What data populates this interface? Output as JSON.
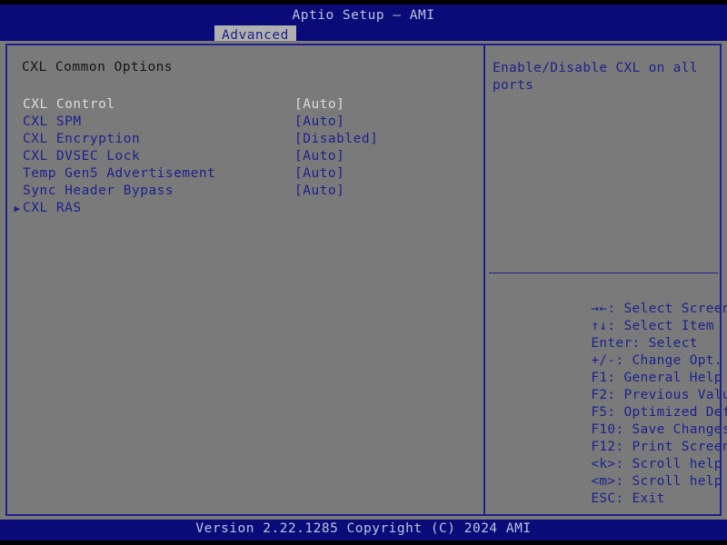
{
  "titlebar": {
    "app_title": "Aptio Setup – AMI",
    "tabs": [
      {
        "label": "Advanced",
        "active": true
      }
    ]
  },
  "main": {
    "section_heading": "CXL Common Options",
    "settings": [
      {
        "label": "CXL Control",
        "value": "[Auto]",
        "selected": true,
        "submenu": false
      },
      {
        "label": "CXL SPM",
        "value": "[Auto]",
        "selected": false,
        "submenu": false
      },
      {
        "label": "CXL Encryption",
        "value": "[Disabled]",
        "selected": false,
        "submenu": false
      },
      {
        "label": "CXL DVSEC Lock",
        "value": "[Auto]",
        "selected": false,
        "submenu": false
      },
      {
        "label": "Temp Gen5 Advertisement",
        "value": "[Auto]",
        "selected": false,
        "submenu": false
      },
      {
        "label": "Sync Header Bypass",
        "value": "[Auto]",
        "selected": false,
        "submenu": false
      },
      {
        "label": "CXL RAS",
        "value": "",
        "selected": false,
        "submenu": true
      }
    ],
    "submenu_glyph": "▶"
  },
  "help_panel": {
    "help_text": "Enable/Disable CXL on all ports",
    "shortcuts": [
      {
        "key": "→←",
        "action": ": Select Screen"
      },
      {
        "key": "↑↓",
        "action": ": Select Item"
      },
      {
        "key": "Enter",
        "action": ": Select"
      },
      {
        "key": "+/-",
        "action": ": Change Opt."
      },
      {
        "key": "F1",
        "action": ": General Help"
      },
      {
        "key": "F2",
        "action": ": Previous Values"
      },
      {
        "key": "F5",
        "action": ": Optimized Defaults"
      },
      {
        "key": "F10",
        "action": ": Save Changes & Reset"
      },
      {
        "key": "F12",
        "action": ": Print Screen"
      },
      {
        "key": "<k>",
        "action": ": Scroll help area upwards"
      },
      {
        "key": "<m>",
        "action": ": Scroll help area downwards"
      },
      {
        "key": "ESC",
        "action": ": Exit"
      }
    ]
  },
  "footer": {
    "version_text": "Version 2.22.1285 Copyright (C) 2024 AMI"
  },
  "colors": {
    "title_bar_blue": "#0a0a78",
    "panel_gray": "#7a7a7a",
    "border_blue": "#20208c",
    "tab_active_bg": "#b0b0b0",
    "selected_text": "#dcdcdc",
    "title_text": "#b9c4e2"
  }
}
